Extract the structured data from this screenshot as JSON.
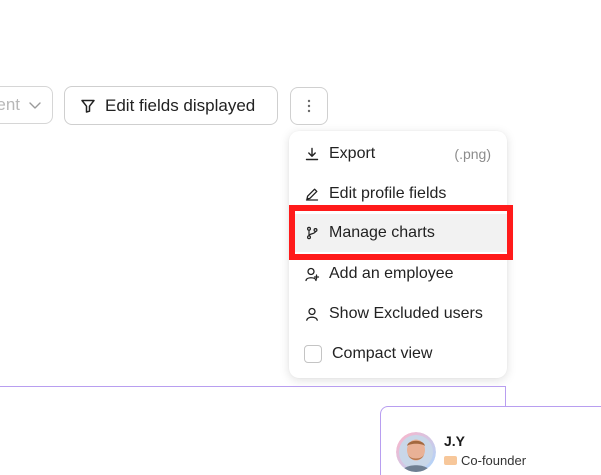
{
  "toolbar": {
    "filter_select_value": "ent",
    "edit_fields_label": "Edit fields displayed"
  },
  "menu": {
    "items": [
      {
        "icon": "download-icon",
        "label": "Export",
        "hint": "(.png)"
      },
      {
        "icon": "pencil-icon",
        "label": "Edit profile fields"
      },
      {
        "icon": "git-branch-icon",
        "label": "Manage charts",
        "state": "hover"
      },
      {
        "icon": "user-add-icon",
        "label": "Add an employee"
      },
      {
        "icon": "user-icon",
        "label": "Show Excluded users"
      },
      {
        "icon": "checkbox",
        "label": "Compact view",
        "checked": false
      }
    ]
  },
  "org_chart": {
    "card": {
      "name": "J.Y",
      "role": "Co-founder"
    }
  },
  "colors": {
    "highlight": "#ff1a1a",
    "chart_line": "#b89ef0",
    "role_tag": "#f7c79a"
  }
}
